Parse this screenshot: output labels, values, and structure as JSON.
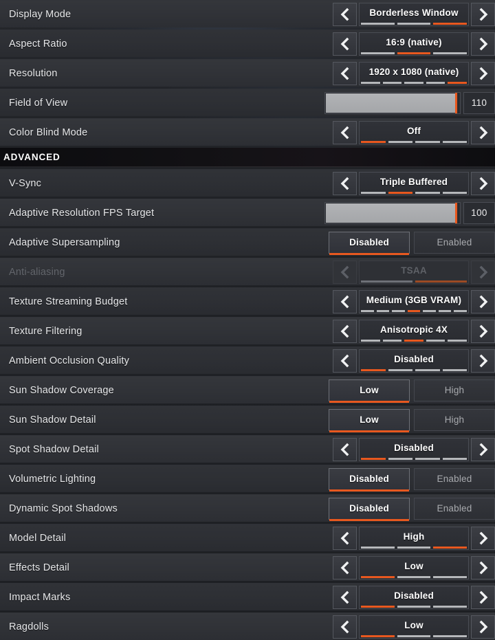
{
  "screen": {
    "accent_color": "#e8581f",
    "row_bg": "#303237",
    "section_bg": "#0f0e12",
    "text_color": "#e7e8ea"
  },
  "sections": [
    {
      "id": "display",
      "header": null,
      "rows": [
        {
          "name": "display-mode",
          "label": "Display Mode",
          "control": "arrow",
          "value": "Borderless Window",
          "segments": 3,
          "active_segment": 3,
          "disabled": false
        },
        {
          "name": "aspect-ratio",
          "label": "Aspect Ratio",
          "control": "arrow",
          "value": "16:9 (native)",
          "segments": 3,
          "active_segment": 2,
          "disabled": false
        },
        {
          "name": "resolution",
          "label": "Resolution",
          "control": "arrow",
          "value": "1920 x 1080 (native)",
          "segments": 5,
          "active_segment": 5,
          "disabled": false
        },
        {
          "name": "field-of-view",
          "label": "Field of View",
          "control": "slider",
          "value": "110",
          "fill_percent": 97,
          "disabled": false
        },
        {
          "name": "color-blind-mode",
          "label": "Color Blind Mode",
          "control": "arrow",
          "value": "Off",
          "segments": 4,
          "active_segment": 1,
          "disabled": false
        }
      ]
    },
    {
      "id": "advanced",
      "header": "ADVANCED",
      "rows": [
        {
          "name": "v-sync",
          "label": "V-Sync",
          "control": "arrow",
          "value": "Triple Buffered",
          "segments": 4,
          "active_segment": 2,
          "disabled": false
        },
        {
          "name": "adaptive-resolution-fps-target",
          "label": "Adaptive Resolution FPS Target",
          "control": "slider",
          "value": "100",
          "fill_percent": 97,
          "disabled": false
        },
        {
          "name": "adaptive-supersampling",
          "label": "Adaptive Supersampling",
          "control": "toggle",
          "options": [
            "Disabled",
            "Enabled"
          ],
          "selected_index": 0,
          "disabled": false
        },
        {
          "name": "anti-aliasing",
          "label": "Anti-aliasing",
          "control": "arrow",
          "value": "TSAA",
          "segments": 2,
          "active_segment": 2,
          "disabled": true
        },
        {
          "name": "texture-streaming-budget",
          "label": "Texture Streaming Budget",
          "control": "arrow",
          "value": "Medium (3GB VRAM)",
          "segments": 7,
          "active_segment": 4,
          "disabled": false
        },
        {
          "name": "texture-filtering",
          "label": "Texture Filtering",
          "control": "arrow",
          "value": "Anisotropic 4X",
          "segments": 5,
          "active_segment": 3,
          "disabled": false
        },
        {
          "name": "ambient-occlusion-quality",
          "label": "Ambient Occlusion Quality",
          "control": "arrow",
          "value": "Disabled",
          "segments": 4,
          "active_segment": 1,
          "disabled": false
        },
        {
          "name": "sun-shadow-coverage",
          "label": "Sun Shadow Coverage",
          "control": "toggle",
          "options": [
            "Low",
            "High"
          ],
          "selected_index": 0,
          "disabled": false
        },
        {
          "name": "sun-shadow-detail",
          "label": "Sun Shadow Detail",
          "control": "toggle",
          "options": [
            "Low",
            "High"
          ],
          "selected_index": 0,
          "disabled": false
        },
        {
          "name": "spot-shadow-detail",
          "label": "Spot Shadow Detail",
          "control": "arrow",
          "value": "Disabled",
          "segments": 4,
          "active_segment": 1,
          "disabled": false
        },
        {
          "name": "volumetric-lighting",
          "label": "Volumetric Lighting",
          "control": "toggle",
          "options": [
            "Disabled",
            "Enabled"
          ],
          "selected_index": 0,
          "disabled": false
        },
        {
          "name": "dynamic-spot-shadows",
          "label": "Dynamic Spot Shadows",
          "control": "toggle",
          "options": [
            "Disabled",
            "Enabled"
          ],
          "selected_index": 0,
          "disabled": false
        },
        {
          "name": "model-detail",
          "label": "Model Detail",
          "control": "arrow",
          "value": "High",
          "segments": 3,
          "active_segment": 3,
          "disabled": false
        },
        {
          "name": "effects-detail",
          "label": "Effects Detail",
          "control": "arrow",
          "value": "Low",
          "segments": 3,
          "active_segment": 1,
          "disabled": false
        },
        {
          "name": "impact-marks",
          "label": "Impact Marks",
          "control": "arrow",
          "value": "Disabled",
          "segments": 3,
          "active_segment": 1,
          "disabled": false
        },
        {
          "name": "ragdolls",
          "label": "Ragdolls",
          "control": "arrow",
          "value": "Low",
          "segments": 3,
          "active_segment": 1,
          "disabled": false
        }
      ]
    }
  ],
  "icons": {
    "prev": "chevron-left-icon",
    "next": "chevron-right-icon"
  }
}
